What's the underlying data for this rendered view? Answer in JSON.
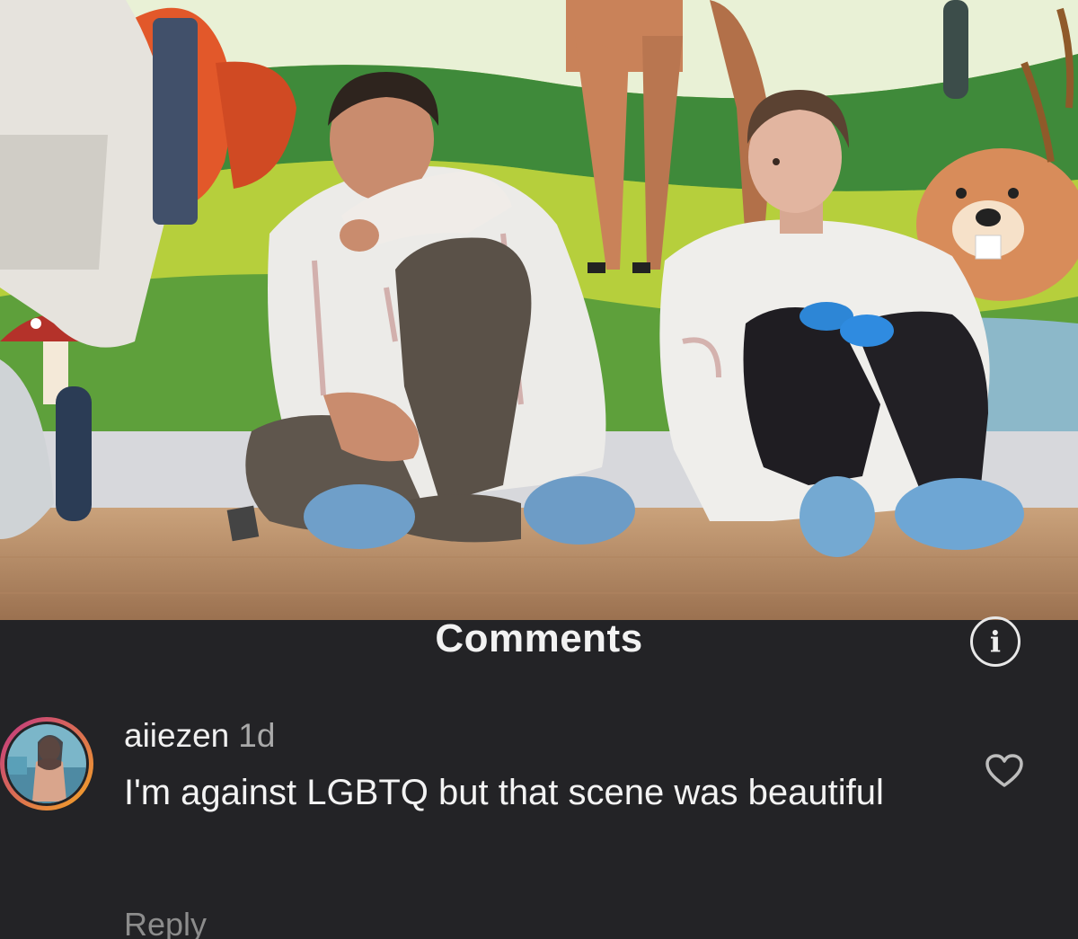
{
  "panel": {
    "title": "Comments",
    "info_icon": "info-circle-icon"
  },
  "comment": {
    "username": "aiiezen",
    "time": "1d",
    "text": "I'm against LGBTQ but that scene was beautiful",
    "reply_label": "Reply",
    "like_icon": "heart-outline-icon",
    "avatar_icon": "user-avatar-ring"
  },
  "colors": {
    "panel_bg": "#232326",
    "text_primary": "#f2f2f2",
    "text_secondary": "#a9a9a9",
    "avatar_ring_start": "#c13584",
    "avatar_ring_end": "#f5a623"
  }
}
